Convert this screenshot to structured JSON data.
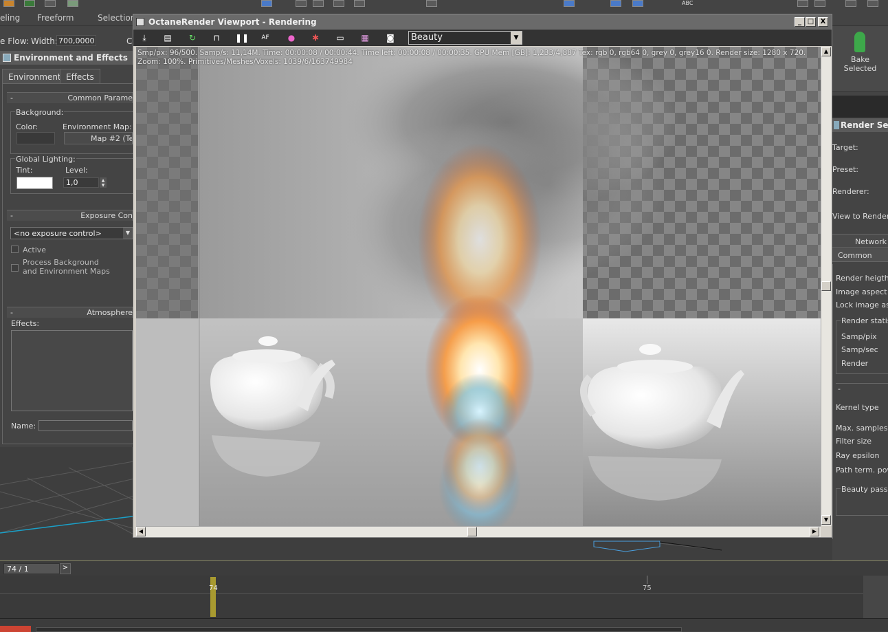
{
  "toolbar": {
    "tabs": [
      "eling",
      "Freeform",
      "Selection"
    ],
    "flow_label": "e Flow:",
    "width_label": "Width:",
    "width_value": "700,0000",
    "extra_label": "C",
    "abc_label": "ABC"
  },
  "env": {
    "title": "Environment and Effects",
    "tabs": [
      "Environment",
      "Effects"
    ],
    "common_params": "Common Parame",
    "background_label": "Background:",
    "color_label": "Color:",
    "env_map_label": "Environment Map:",
    "env_map_value": "Map #2  (Te",
    "global_lighting_label": "Global Lighting:",
    "tint_label": "Tint:",
    "level_label": "Level:",
    "level_value": "1,0",
    "exposure_title": "Exposure Con",
    "exposure_select": "<no exposure control>",
    "active_label": "Active",
    "process_bg_label_1": "Process Background",
    "process_bg_label_2": "and Environment Maps",
    "atmosphere_title": "Atmosphere",
    "effects_label": "Effects:",
    "name_label": "Name:",
    "minus": "-"
  },
  "octane": {
    "title": "OctaneRender Viewport - Rendering",
    "pass_select": "Beauty",
    "stats_line1": "Smp/px: 96/500.   Samp/s: 11,14M.   Time: 00:00:08 / 00:00:44.   Time left: 00:00:08 / 00:00:35.   GPU Mem [GB]: 1,233/4,887   Tex: rgb 0, rgb64 0, grey 0, grey16 0.   Render size: 1280 x 720.",
    "stats_line2": "Zoom: 100%.   Primitives/Meshes/Voxels: 1039/6/163749984",
    "win_min": "_",
    "win_max": "□",
    "win_close": "X"
  },
  "right": {
    "bake_line1": "Bake",
    "bake_line2": "Selected",
    "render_setup_title": "Render Setu",
    "target_label": "Target:",
    "preset_label": "Preset:",
    "renderer_label": "Renderer:",
    "view_label": "View to Render:",
    "network_tab": "Network",
    "common_tab": "Common",
    "render_height": "Render heigth",
    "image_aspect": "Image aspect",
    "lock_aspect": "Lock image aspe",
    "render_stats": "Render statist",
    "samp_pix": "Samp/pix",
    "samp_sec": "Samp/sec",
    "render": "Render",
    "minus": "-",
    "kernel_type": "Kernel type",
    "max_samples": "Max. samples",
    "filter_size": "Filter size",
    "ray_epsilon": "Ray epsilon",
    "path_term": "Path term. powe",
    "beauty_passes": "Beauty passes"
  },
  "timeline": {
    "frame_field": "74 / 1",
    "next": ">",
    "marker_74": "74",
    "marker_75": "75"
  }
}
